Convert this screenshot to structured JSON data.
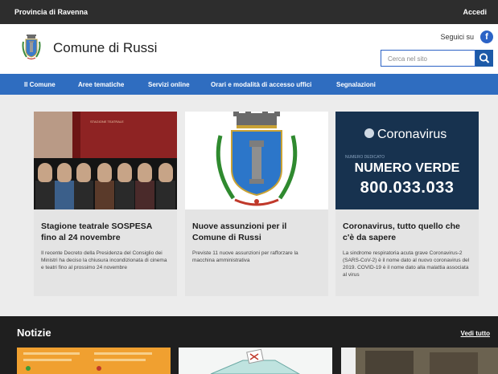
{
  "topbar": {
    "organization": "Provincia di Ravenna",
    "login": "Accedi"
  },
  "header": {
    "site_title": "Comune di Russi",
    "follow_label": "Seguici su",
    "facebook_glyph": "f",
    "search_placeholder": "Cerca nel sito"
  },
  "nav": {
    "items": [
      {
        "label": "Il Comune"
      },
      {
        "label": "Aree tematiche"
      },
      {
        "label": "Servizi online"
      },
      {
        "label": "Orari e modalità di accesso uffici"
      },
      {
        "label": "Segnalazioni"
      }
    ]
  },
  "cards": [
    {
      "title": "Stagione teatrale SOSPESA fino al 24 novembre",
      "text": "Il recente Decreto della Presidenza del Consiglio dei Ministri ha deciso la chiusura incondizionata di cinema e teatri fino al prossimo 24 novembre",
      "image": "theatre-season-poster",
      "poster_text": "STAGIONE TEATRALE"
    },
    {
      "title": "Nuove assunzioni per il Comune di Russi",
      "text": "Previste 11 nuove assunzioni per rafforzare la macchina amministrativa",
      "image": "municipal-crest"
    },
    {
      "title": "Coronavirus, tutto quello che c'è da sapere",
      "text": "La sindrome respiratoria acuta grave Coronavirus-2 (SARS-CoV-2) è il nome dato al nuovo coronavirus del 2019. COVID-19 è il nome dato alla malattia associata al virus",
      "image": "coronavirus-banner",
      "banner_title": "Coronavirus",
      "banner_small": "NUMERO DEDICATO",
      "banner_line": "NUMERO VERDE",
      "banner_number": "800.033.033"
    }
  ],
  "news": {
    "title": "Notizie",
    "see_all": "Vedi tutto"
  },
  "colors": {
    "topbar": "#2d2d2d",
    "nav": "#2f6dc0",
    "accent": "#1d5aa8",
    "content_bg": "#ececec",
    "covid_bg": "#17324f",
    "theatre_bg": "#8e2323"
  }
}
